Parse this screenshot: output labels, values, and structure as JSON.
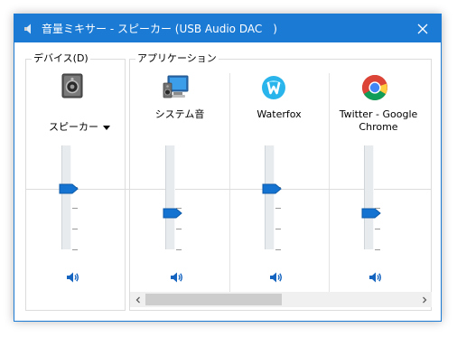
{
  "window": {
    "title": "音量ミキサー - スピーカー (USB Audio DAC　)",
    "accent_color": "#1a7ad4",
    "icons": {
      "title": "speaker-icon",
      "close": "close-icon"
    }
  },
  "device_group": {
    "label": "デバイス(D)",
    "device_name": "スピーカー",
    "icon": "speaker-device-icon",
    "volume_level": 0.58,
    "mute_icon": "speaker-sound-icon"
  },
  "applications_group": {
    "label": "アプリケーション",
    "apps": [
      {
        "name": "システム音",
        "icon": "system-sounds-icon",
        "volume_level": 0.35,
        "mute_icon": "speaker-sound-icon"
      },
      {
        "name": "Waterfox",
        "icon": "waterfox-icon",
        "volume_level": 0.58,
        "mute_icon": "speaker-sound-icon"
      },
      {
        "name": "Twitter - Google Chrome",
        "icon": "chrome-icon",
        "volume_level": 0.35,
        "mute_icon": "speaker-sound-icon"
      }
    ]
  },
  "scrollbar": {
    "left_arrow": "chevron-left-icon",
    "right_arrow": "chevron-right-icon"
  }
}
